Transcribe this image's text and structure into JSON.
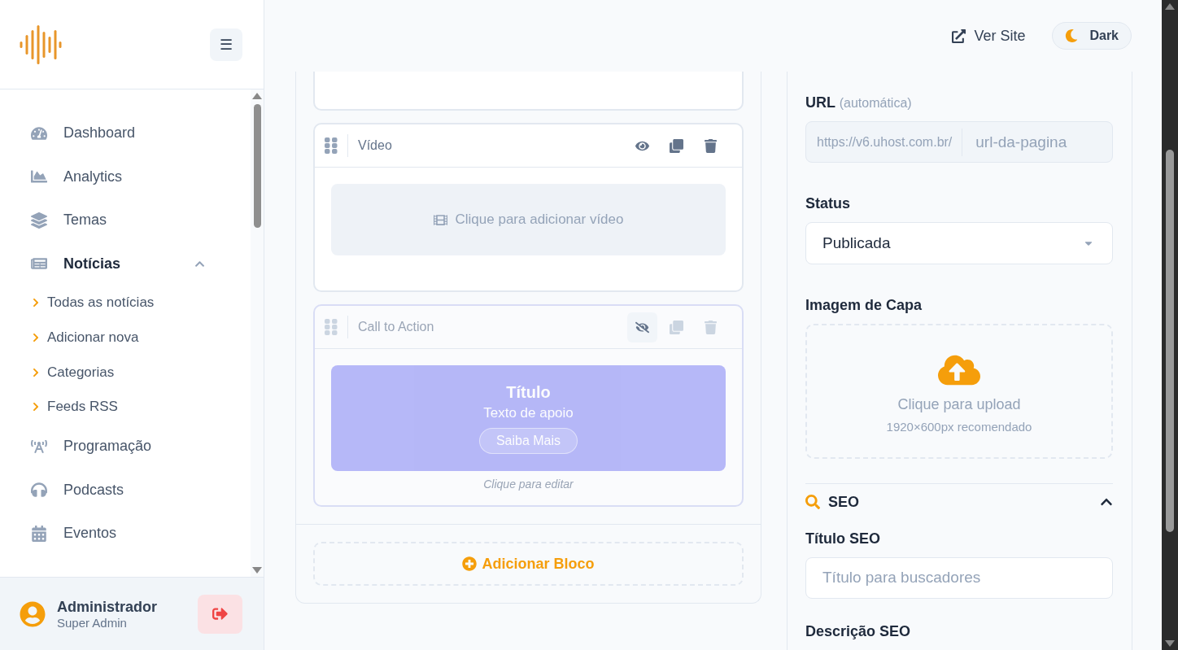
{
  "sidebar": {
    "menu_button": "☰",
    "nav": [
      {
        "label": "Dashboard",
        "selected": false
      },
      {
        "label": "Analytics",
        "selected": false
      },
      {
        "label": "Temas",
        "selected": false
      },
      {
        "label": "Notícias",
        "selected": true,
        "expanded": true,
        "children": [
          {
            "label": "Todas as notícias"
          },
          {
            "label": "Adicionar nova"
          },
          {
            "label": "Categorias"
          },
          {
            "label": "Feeds RSS"
          }
        ]
      },
      {
        "label": "Programação",
        "selected": false
      },
      {
        "label": "Podcasts",
        "selected": false
      },
      {
        "label": "Eventos",
        "selected": false
      }
    ],
    "user": {
      "name": "Administrador",
      "role": "Super Admin"
    }
  },
  "header": {
    "view_site": "Ver Site",
    "theme_toggle": "Dark"
  },
  "editor": {
    "blocks": [
      {
        "kind": "cut"
      },
      {
        "kind": "video",
        "title": "Vídeo",
        "visible": true,
        "prompt": "Clique para adicionar vídeo"
      },
      {
        "kind": "cta",
        "title": "Call to Action",
        "visible": false,
        "heading": "Título",
        "text": "Texto de apoio",
        "button": "Saiba Mais",
        "hint": "Clique para editar"
      }
    ],
    "add_block": "Adicionar Bloco"
  },
  "settings": {
    "url": {
      "label": "URL",
      "note": "(automática)",
      "prefix": "https://v6.uhost.com.br/",
      "placeholder": "url-da-pagina"
    },
    "status": {
      "label": "Status",
      "value": "Publicada"
    },
    "cover": {
      "label": "Imagem de Capa",
      "prompt": "Clique para upload",
      "hint": "1920×600px recomendado"
    },
    "seo": {
      "title": "SEO",
      "expanded": true,
      "fields": [
        {
          "label": "Título SEO",
          "placeholder": "Título para buscadores"
        }
      ],
      "next_label": "Descrição SEO"
    }
  }
}
